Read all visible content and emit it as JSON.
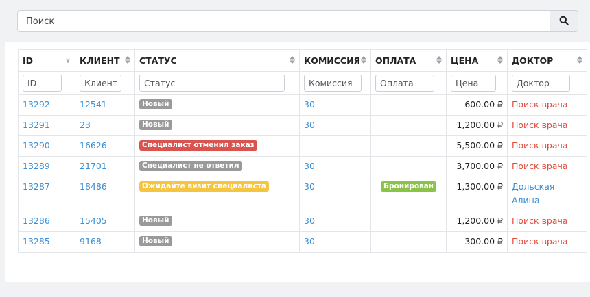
{
  "search": {
    "placeholder": "Поиск"
  },
  "columns": [
    {
      "label": "ID",
      "filter": "ID"
    },
    {
      "label": "КЛИЕНТ",
      "filter": "Клиент"
    },
    {
      "label": "СТАТУС",
      "filter": "Статус"
    },
    {
      "label": "КОМИССИЯ",
      "filter": "Комиссия"
    },
    {
      "label": "ОПЛАТА",
      "filter": "Оплата"
    },
    {
      "label": "ЦЕНА",
      "filter": "Цена"
    },
    {
      "label": "ДОКТОР",
      "filter": "Доктор"
    }
  ],
  "colors": {
    "link": "#3a8fd9",
    "red": "#e04b3c",
    "gray_badge": "#9a9a9a",
    "red_badge": "#d9534f",
    "yellow_badge": "#f5c440",
    "green_badge": "#8bc34a"
  },
  "rows": [
    {
      "id": "13292",
      "client": "12541",
      "status": "Новый",
      "commission": "30",
      "payment": "",
      "price": "600.00 ₽",
      "doctor": "Поиск врача"
    },
    {
      "id": "13291",
      "client": "23",
      "status": "Новый",
      "commission": "30",
      "payment": "",
      "price": "1,200.00 ₽",
      "doctor": "Поиск врача"
    },
    {
      "id": "13290",
      "client": "16626",
      "status": "Специалист отменил заказ",
      "commission": "",
      "payment": "",
      "price": "5,500.00 ₽",
      "doctor": "Поиск врача"
    },
    {
      "id": "13289",
      "client": "21701",
      "status": "Специалист не ответил",
      "commission": "30",
      "payment": "",
      "price": "3,700.00 ₽",
      "doctor": "Поиск врача"
    },
    {
      "id": "13287",
      "client": "18486",
      "status": "Ожидайте визит специалиста",
      "commission": "30",
      "payment": "Бронирован",
      "price": "1,300.00 ₽",
      "doctor_line1": "Дольская",
      "doctor_line2": "Алина"
    },
    {
      "id": "13286",
      "client": "15405",
      "status": "Новый",
      "commission": "30",
      "payment": "",
      "price": "1,200.00 ₽",
      "doctor": "Поиск врача"
    },
    {
      "id": "13285",
      "client": "9168",
      "status": "Новый",
      "commission": "30",
      "payment": "",
      "price": "300.00 ₽",
      "doctor": "Поиск врача"
    }
  ]
}
